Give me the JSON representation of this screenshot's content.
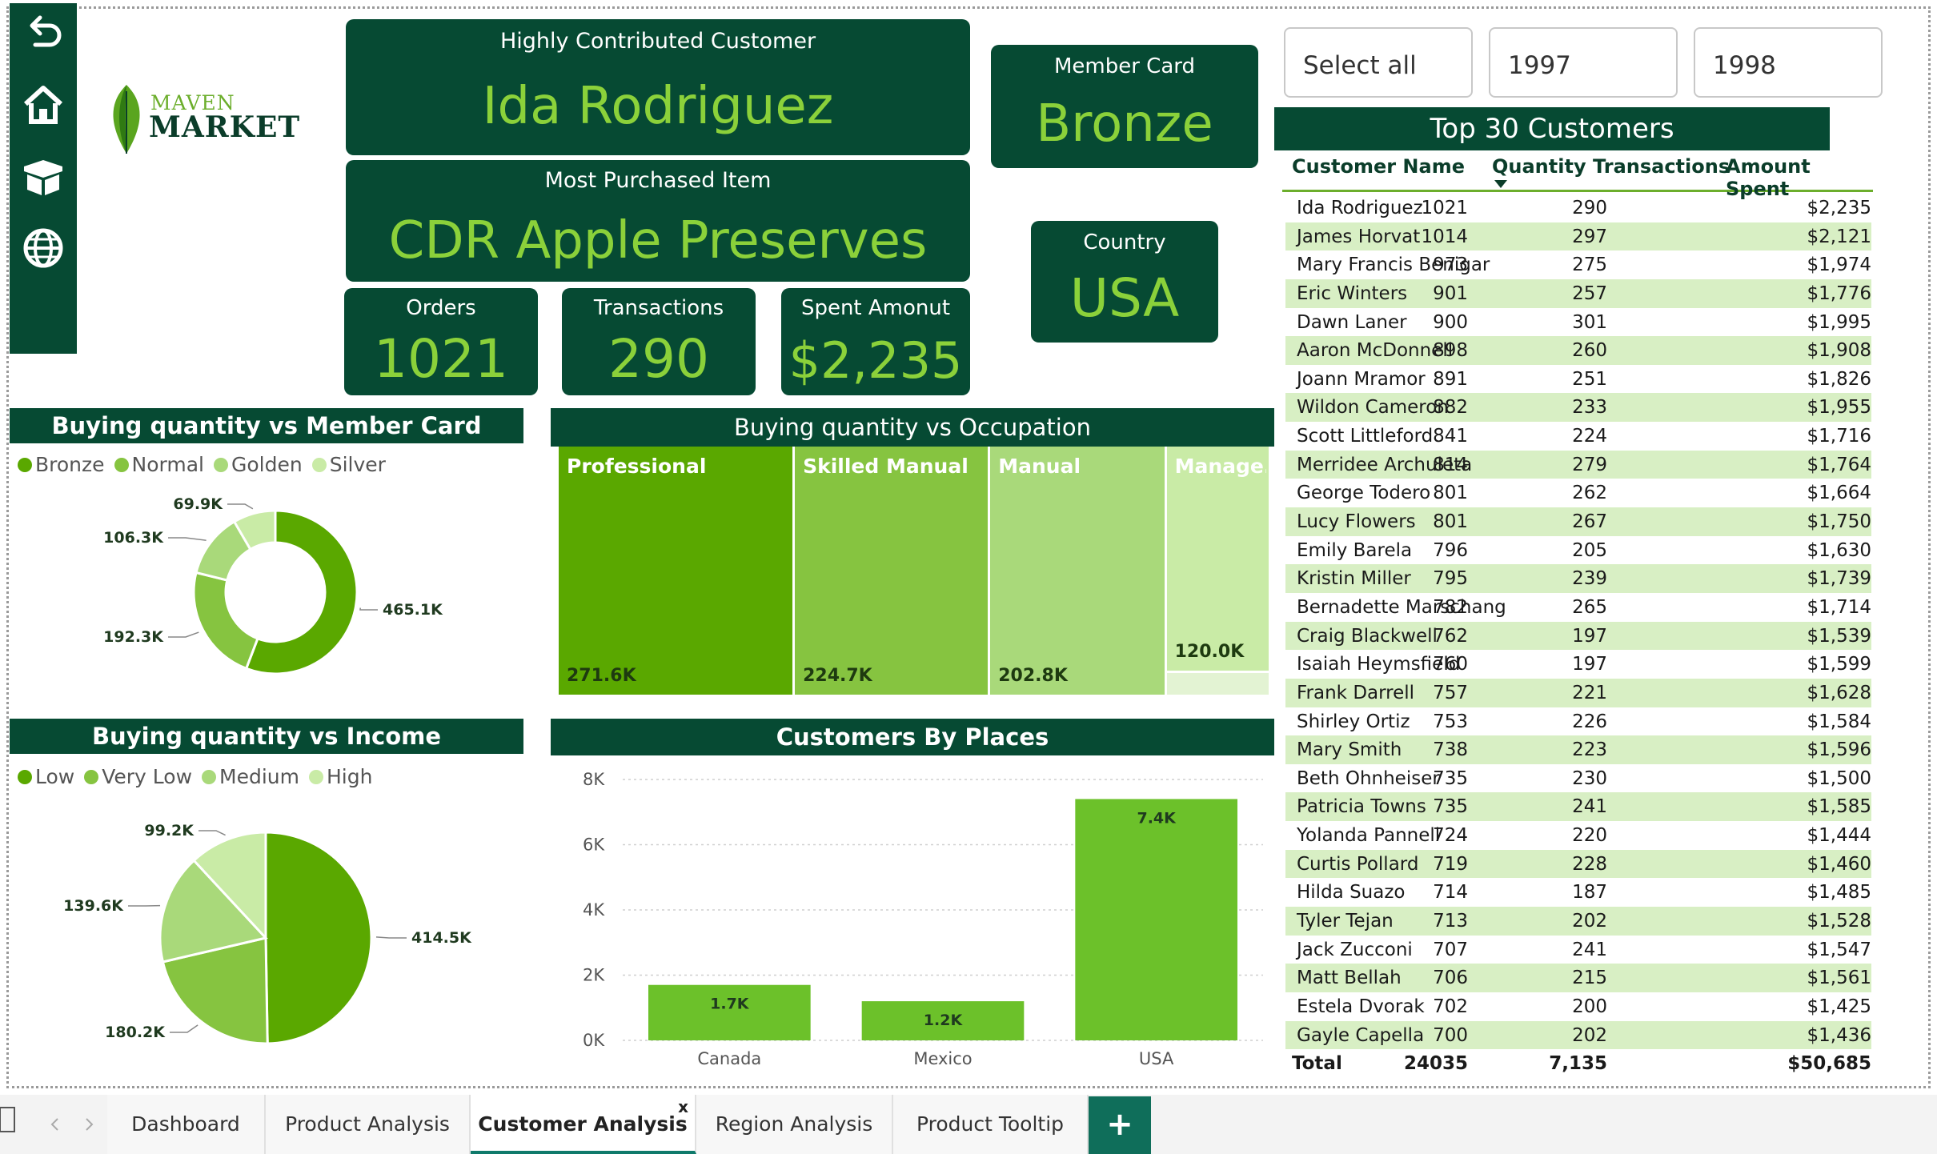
{
  "brand": {
    "logo_top": "MAVEN",
    "logo_bottom": "MARKET",
    "leaf_color": "#5aa51f"
  },
  "nav": {
    "icons": [
      "back-arrow-icon",
      "home-icon",
      "box-icon",
      "globe-icon"
    ]
  },
  "kpis": {
    "top_customer": {
      "caption": "Highly Contributed Customer",
      "value": "Ida Rodriguez"
    },
    "top_item": {
      "caption": "Most Purchased Item",
      "value": "CDR Apple Preserves"
    },
    "member_card": {
      "caption": "Member Card",
      "value": "Bronze"
    },
    "country": {
      "caption": "Country",
      "value": "USA"
    },
    "orders": {
      "caption": "Orders",
      "value": "1021"
    },
    "transactions": {
      "caption": "Transactions",
      "value": "290"
    },
    "spent": {
      "caption": "Spent Amonut",
      "value": "$2,235"
    }
  },
  "slicer": {
    "options": [
      "Select all",
      "1997",
      "1998"
    ]
  },
  "colors": {
    "dark_green": "#064a33",
    "accent": "#8bd13a",
    "c1": "#5aa800",
    "c2": "#86c440",
    "c3": "#a9d97a",
    "c4": "#c9eba6"
  },
  "member_chart": {
    "title": "Buying quantity vs Member Card",
    "chart_data": {
      "type": "pie",
      "categories": [
        "Bronze",
        "Normal",
        "Golden",
        "Silver"
      ],
      "values": [
        465.1,
        192.3,
        106.3,
        69.9
      ],
      "labels": [
        "465.1K",
        "192.3K",
        "106.3K",
        "69.9K"
      ],
      "donut": true
    }
  },
  "income_chart": {
    "title": "Buying quantity vs Income",
    "chart_data": {
      "type": "pie",
      "categories": [
        "Low",
        "Very Low",
        "Medium",
        "High"
      ],
      "values": [
        414.5,
        180.2,
        139.6,
        99.2
      ],
      "labels": [
        "414.5K",
        "180.2K",
        "139.6K",
        "99.2K"
      ],
      "donut": false
    }
  },
  "occupation_chart": {
    "title": "Buying quantity vs Occupation",
    "chart_data": {
      "type": "treemap",
      "categories": [
        "Professional",
        "Skilled Manual",
        "Manual",
        "Manage..."
      ],
      "values": [
        271.6,
        224.7,
        202.8,
        120.0
      ],
      "labels": [
        "271.6K",
        "224.7K",
        "202.8K",
        "120.0K"
      ]
    }
  },
  "places_chart": {
    "title": "Customers By Places",
    "chart_data": {
      "type": "bar",
      "categories": [
        "Canada",
        "Mexico",
        "USA"
      ],
      "values": [
        1.7,
        1.2,
        7.4
      ],
      "labels": [
        "1.7K",
        "1.2K",
        "7.4K"
      ],
      "yticks": [
        "0K",
        "2K",
        "4K",
        "6K",
        "8K"
      ],
      "ylim": [
        0,
        8
      ],
      "grid": true
    }
  },
  "table": {
    "title": "Top 30 Customers",
    "headers": [
      "Customer Name",
      "Quantity",
      "Transactions",
      "Amount Spent"
    ],
    "rows": [
      [
        "Ida Rodriguez",
        "1021",
        "290",
        "$2,235"
      ],
      [
        "James Horvat",
        "1014",
        "297",
        "$2,121"
      ],
      [
        "Mary Francis Benigar",
        "973",
        "275",
        "$1,974"
      ],
      [
        "Eric Winters",
        "901",
        "257",
        "$1,776"
      ],
      [
        "Dawn Laner",
        "900",
        "301",
        "$1,995"
      ],
      [
        "Aaron McDonnell",
        "898",
        "260",
        "$1,908"
      ],
      [
        "Joann Mramor",
        "891",
        "251",
        "$1,826"
      ],
      [
        "Wildon Cameron",
        "882",
        "233",
        "$1,955"
      ],
      [
        "Scott Littleford",
        "841",
        "224",
        "$1,716"
      ],
      [
        "Merridee Archuleta",
        "814",
        "279",
        "$1,764"
      ],
      [
        "George Todero",
        "801",
        "262",
        "$1,664"
      ],
      [
        "Lucy Flowers",
        "801",
        "267",
        "$1,750"
      ],
      [
        "Emily Barela",
        "796",
        "205",
        "$1,630"
      ],
      [
        "Kristin Miller",
        "795",
        "239",
        "$1,739"
      ],
      [
        "Bernadette Marschang",
        "782",
        "265",
        "$1,714"
      ],
      [
        "Craig Blackwell",
        "762",
        "197",
        "$1,539"
      ],
      [
        "Isaiah Heymsfield",
        "760",
        "197",
        "$1,599"
      ],
      [
        "Frank Darrell",
        "757",
        "221",
        "$1,628"
      ],
      [
        "Shirley Ortiz",
        "753",
        "226",
        "$1,584"
      ],
      [
        "Mary Smith",
        "738",
        "223",
        "$1,596"
      ],
      [
        "Beth Ohnheiser",
        "735",
        "230",
        "$1,500"
      ],
      [
        "Patricia Towns",
        "735",
        "241",
        "$1,585"
      ],
      [
        "Yolanda Pannell",
        "724",
        "220",
        "$1,444"
      ],
      [
        "Curtis Pollard",
        "719",
        "228",
        "$1,460"
      ],
      [
        "Hilda Suazo",
        "714",
        "187",
        "$1,485"
      ],
      [
        "Tyler Tejan",
        "713",
        "202",
        "$1,528"
      ],
      [
        "Jack Zucconi",
        "707",
        "241",
        "$1,547"
      ],
      [
        "Matt Bellah",
        "706",
        "215",
        "$1,561"
      ],
      [
        "Estela Dvorak",
        "702",
        "200",
        "$1,425"
      ],
      [
        "Gayle Capella",
        "700",
        "202",
        "$1,436"
      ]
    ],
    "total": [
      "Total",
      "24035",
      "7,135",
      "$50,685"
    ]
  },
  "tabs": {
    "items": [
      "Dashboard",
      "Product Analysis",
      "Customer Analysis",
      "Region Analysis",
      "Product Tooltip"
    ],
    "active": "Customer Analysis",
    "close_glyph": "x",
    "add_glyph": "+"
  }
}
